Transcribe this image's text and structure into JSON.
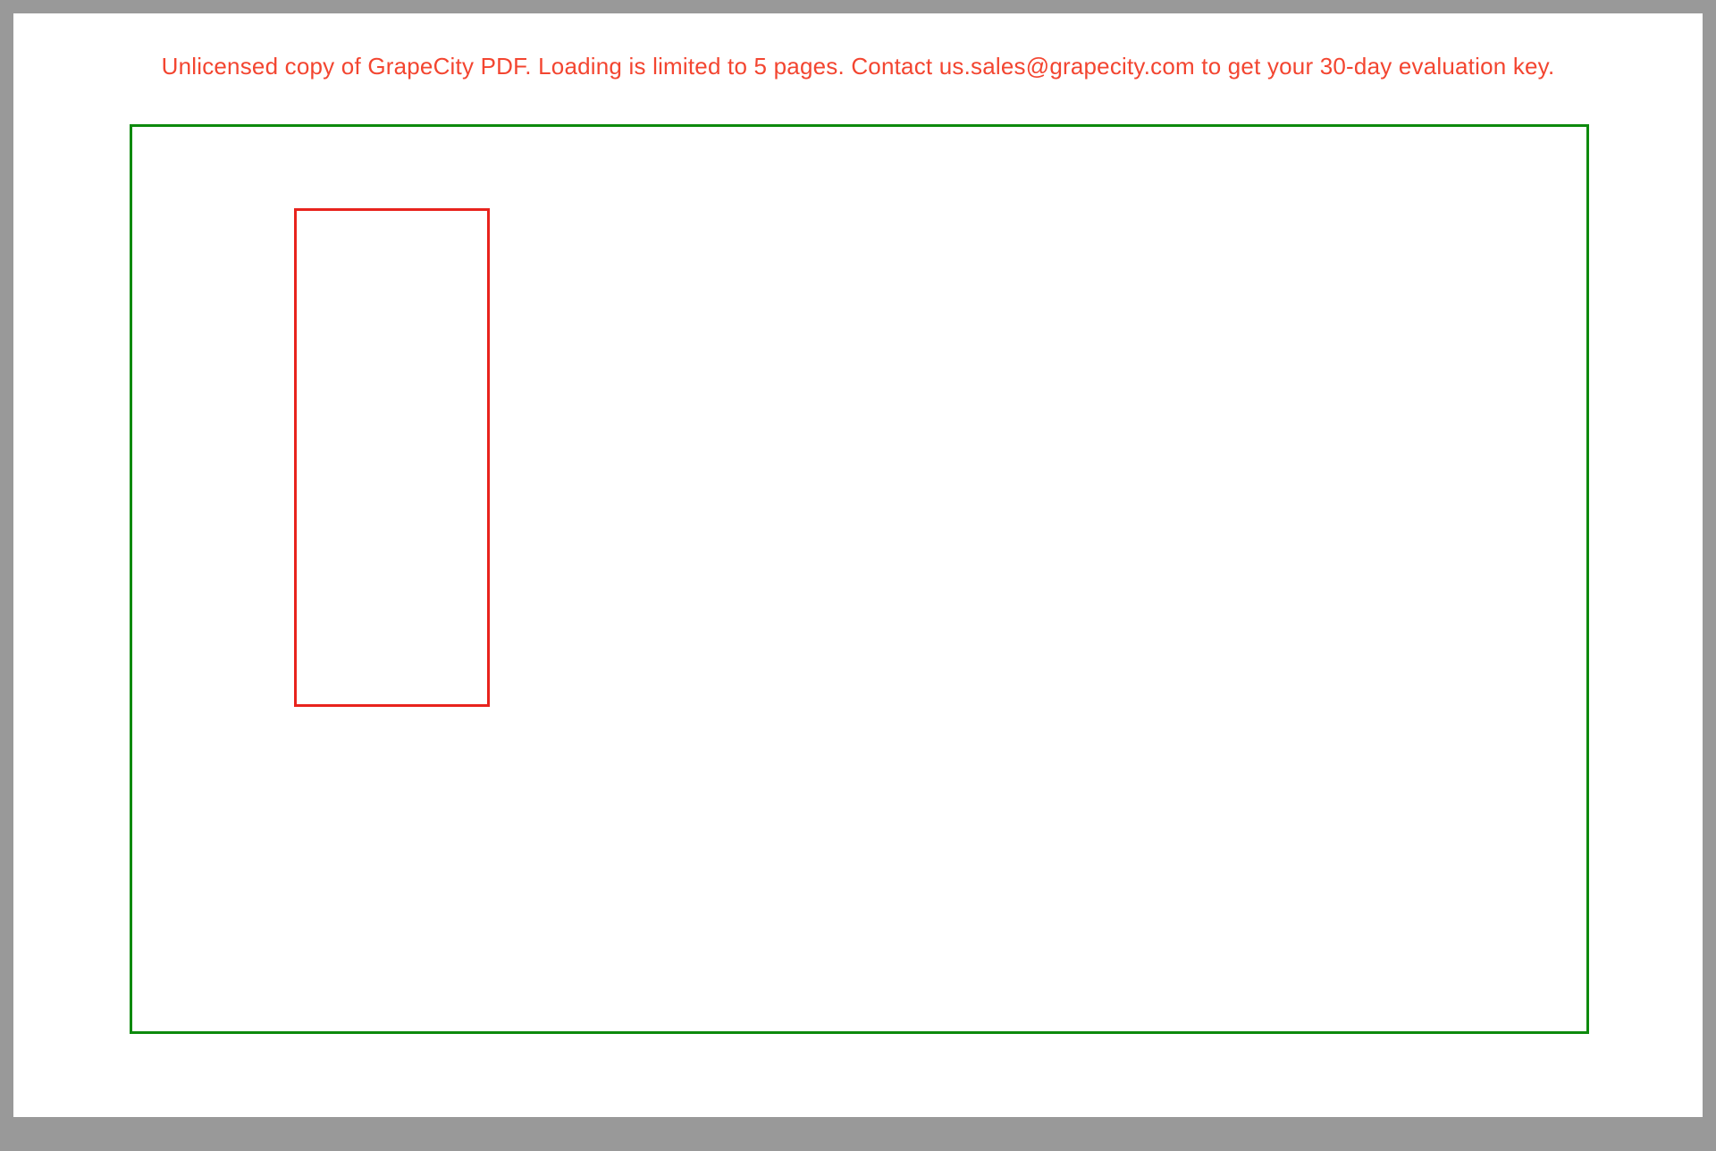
{
  "warning": {
    "message": "Unlicensed copy of GrapeCity PDF. Loading is limited to 5 pages. Contact us.sales@grapecity.com to get your 30-day evaluation key."
  },
  "colors": {
    "warning_text": "#f34530",
    "green_border": "#0d8a0d",
    "red_border": "#e8231d",
    "page_background": "#ffffff",
    "viewer_background": "#999999"
  }
}
